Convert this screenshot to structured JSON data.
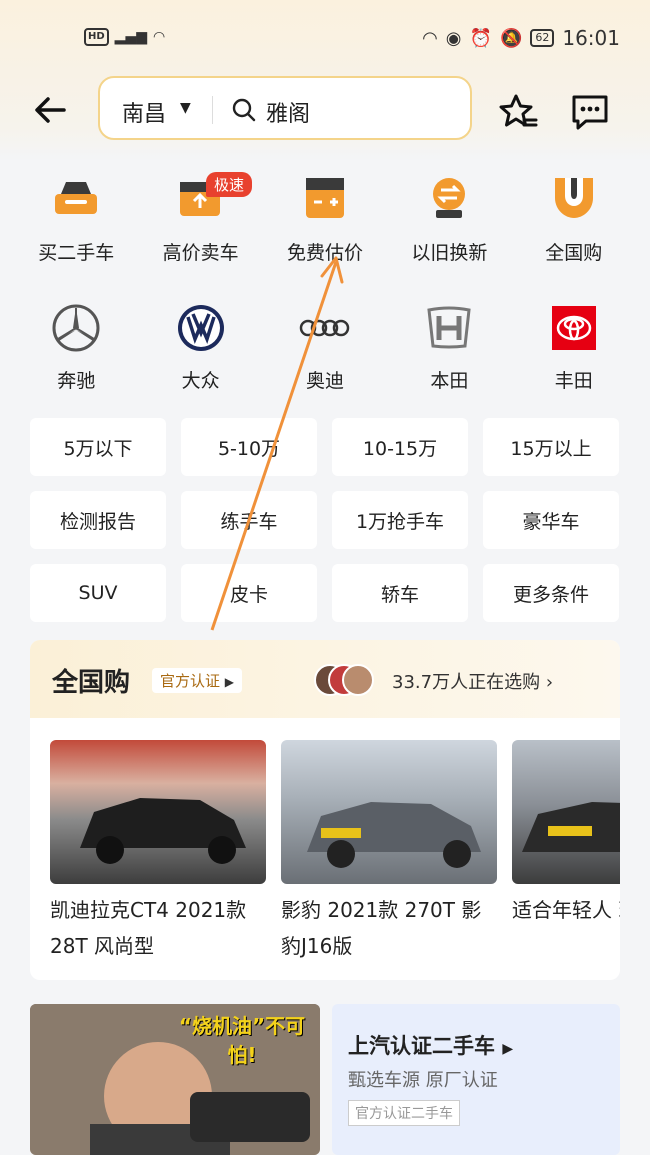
{
  "status": {
    "time": "16:01",
    "battery": "62",
    "hd": "HD"
  },
  "search": {
    "city": "南昌",
    "keyword": "雅阁"
  },
  "nav": [
    {
      "label": "买二手车",
      "icon": "car-icon"
    },
    {
      "label": "高价卖车",
      "icon": "sell-car-icon"
    },
    {
      "label": "免费估价",
      "icon": "calculator-icon"
    },
    {
      "label": "以旧换新",
      "icon": "exchange-icon"
    },
    {
      "label": "全国购",
      "icon": "shield-icon"
    }
  ],
  "nav_badge": "极速",
  "brands": [
    {
      "label": "奔驰",
      "icon": "mercedes-logo"
    },
    {
      "label": "大众",
      "icon": "volkswagen-logo"
    },
    {
      "label": "奥迪",
      "icon": "audi-logo"
    },
    {
      "label": "本田",
      "icon": "honda-logo"
    },
    {
      "label": "丰田",
      "icon": "toyota-logo"
    }
  ],
  "filters": [
    "5万以下",
    "5-10万",
    "10-15万",
    "15万以上",
    "检测报告",
    "练手车",
    "1万抢手车",
    "豪华车",
    "SUV",
    "皮卡",
    "轿车",
    "更多条件"
  ],
  "national": {
    "title": "全国购",
    "cert": "官方认证",
    "count": "33.7万人正在选购",
    "cars": [
      {
        "title": "凯迪拉克CT4 2021款 28T 风尚型"
      },
      {
        "title": "影豹 2021款 270T 影豹J16版"
      },
      {
        "title": "适合年轻人 现代伊兰特"
      }
    ]
  },
  "promo": {
    "video_caption": "“烧机油”不可怕!",
    "title": "上汽认证二手车",
    "subtitle": "甄选车源 原厂认证",
    "tag": "官方认证二手车"
  },
  "colors": {
    "accent": "#f29a2e",
    "badge": "#e8412e",
    "arrow": "#f0913a"
  }
}
